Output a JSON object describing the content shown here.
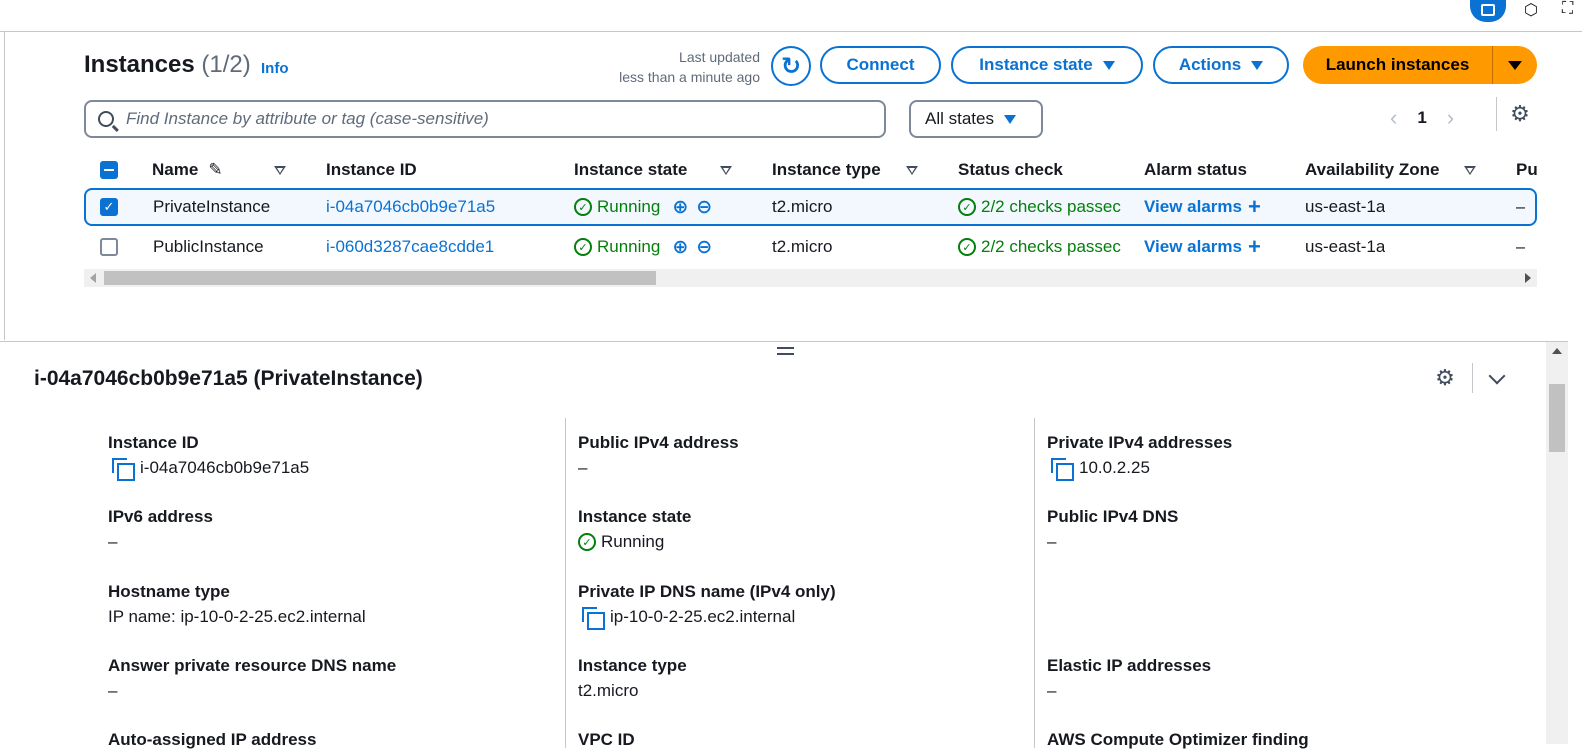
{
  "header": {
    "title": "Instances",
    "count": "(1/2)",
    "info_link": "Info",
    "last_updated_line1": "Last updated",
    "last_updated_line2": "less than a minute ago",
    "refresh_icon": "refresh-icon",
    "connect_label": "Connect",
    "instance_state_label": "Instance state",
    "actions_label": "Actions",
    "launch_label": "Launch instances",
    "accent_color": "#0972d3",
    "launch_color": "#ff9900"
  },
  "search": {
    "placeholder": "Find Instance by attribute or tag (case-sensitive)",
    "value": ""
  },
  "filter": {
    "selected": "All states"
  },
  "pager": {
    "page": "1"
  },
  "table": {
    "columns": [
      "Name",
      "Instance ID",
      "Instance state",
      "Instance type",
      "Status check",
      "Alarm status",
      "Availability Zone",
      "Pu"
    ],
    "rows": [
      {
        "selected": true,
        "name": "PrivateInstance",
        "id": "i-04a7046cb0b9e71a5",
        "state": "Running",
        "type": "t2.micro",
        "status": "2/2 checks passec",
        "alarm": "View alarms",
        "az": "us-east-1a",
        "pub": "–"
      },
      {
        "selected": false,
        "name": "PublicInstance",
        "id": "i-060d3287cae8cdde1",
        "state": "Running",
        "type": "t2.micro",
        "status": "2/2 checks passec",
        "alarm": "View alarms",
        "az": "us-east-1a",
        "pub": "–"
      }
    ]
  },
  "detail": {
    "title": "i-04a7046cb0b9e71a5 (PrivateInstance)",
    "col1": [
      {
        "label": "Instance ID",
        "value": "i-04a7046cb0b9e71a5",
        "copy": true
      },
      {
        "label": "IPv6 address",
        "value": "–"
      },
      {
        "label": "Hostname type",
        "value": "IP name: ip-10-0-2-25.ec2.internal"
      },
      {
        "label": "Answer private resource DNS name",
        "value": "–"
      }
    ],
    "col2": [
      {
        "label": "Public IPv4 address",
        "value": "–"
      },
      {
        "label": "Instance state",
        "value": "Running"
      },
      {
        "label": "Private IP DNS name (IPv4 only)",
        "value": "ip-10-0-2-25.ec2.internal",
        "copy": true
      },
      {
        "label": "Instance type",
        "value": "t2.micro"
      }
    ],
    "col3": [
      {
        "label": "Private IPv4 addresses",
        "value": "10.0.2.25",
        "copy": true
      },
      {
        "label": "Public IPv4 DNS",
        "value": "–"
      },
      {
        "label": "Elastic IP addresses",
        "value": "–"
      }
    ],
    "cut_labels": [
      "Auto-assigned IP address",
      "VPC ID",
      "AWS Compute Optimizer finding"
    ]
  },
  "status_color": "#037f0c"
}
